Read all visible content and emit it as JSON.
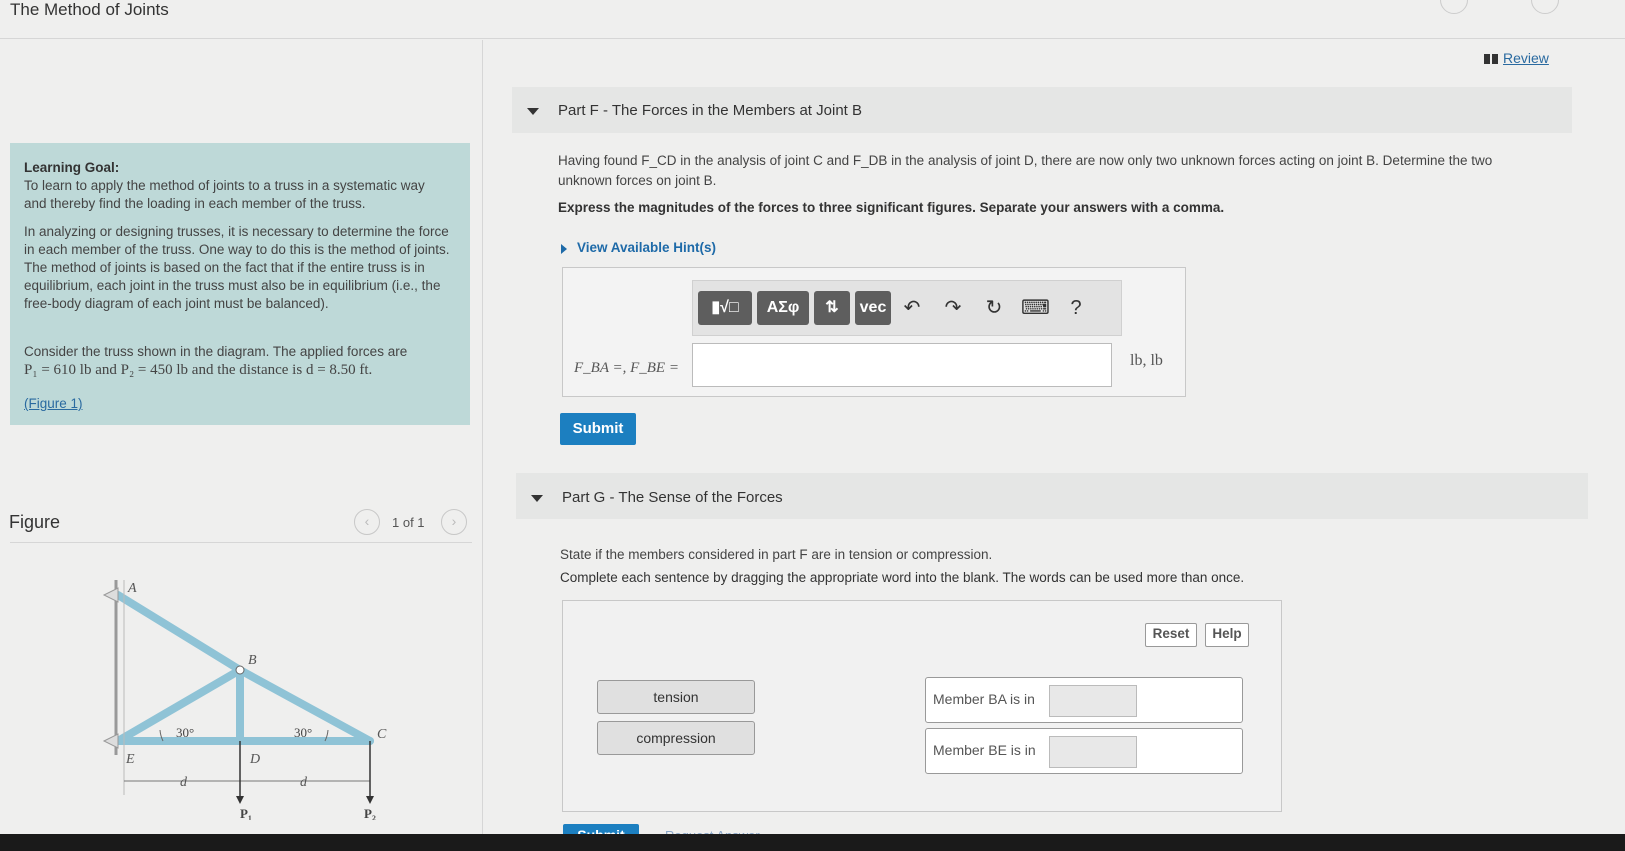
{
  "app": {
    "title": "The Method of Joints"
  },
  "left": {
    "goal_heading": "Learning Goal:",
    "goal_text": "To learn to apply the method of joints to a truss in a systematic way and thereby find the loading in each member of the truss.",
    "analysis_text": "In analyzing or designing trusses, it is necessary to determine the force in each member of the truss. One way to do this is the method of joints. The method of joints is based on the fact that if the entire truss is in equilibrium, each joint in the truss must also be in equilibrium (i.e., the free-body diagram of each joint must be balanced).",
    "consider_line1": "Consider the truss shown in the diagram. The applied forces are",
    "consider_line2": "P₁ = 610 lb and P₂ = 450 lb and the distance is d = 8.50 ft.",
    "figure_link": "(Figure 1)",
    "figure_title": "Figure",
    "pager": "1 of 1",
    "diagram": {
      "label_a": "A",
      "label_b": "B",
      "label_c": "C",
      "label_d": "D",
      "label_e": "E",
      "angle_left": "30°",
      "angle_right": "30°",
      "dim_d": "d",
      "p1": "P₁",
      "p2": "P₂"
    }
  },
  "right": {
    "review": "Review",
    "partF": {
      "title": "Part F - The Forces in the Members at Joint B",
      "q1": "Having found F_CD in the analysis of joint C and F_DB in the analysis of joint D, there are now only two unknown forces acting on joint B. Determine the two",
      "q2": "unknown forces on joint B.",
      "instruction": "Express the magnitudes of the forces to three significant figures. Separate your answers with a comma.",
      "hint": "View Available Hint(s)",
      "toolbar": {
        "template": "▮√□",
        "greek": "ΑΣφ",
        "arrows": "⇅",
        "vec": "vec",
        "undo": "↶",
        "redo": "↷",
        "reset": "↻",
        "keyboard": "⌨",
        "help": "?"
      },
      "eq_label": "F_BA =, F_BE =",
      "answer_value": "",
      "units": "lb, lb",
      "submit": "Submit"
    },
    "partG": {
      "title": "Part G - The Sense of the Forces",
      "q": "State if the members considered in part F are in tension or compression.",
      "instruction": "Complete each sentence by dragging the appropriate word into the blank. The words can be used more than once.",
      "reset": "Reset",
      "help": "Help",
      "words": [
        "tension",
        "compression"
      ],
      "sentence1": "Member BA is in",
      "sentence2": "Member BE is in",
      "submit": "Submit",
      "request": "Request Answer"
    }
  },
  "colors": {
    "goal_bg": "#bed9d8",
    "submit": "#1c7fc0",
    "link": "#2a6aa0",
    "truss": "#8fc3d6"
  }
}
